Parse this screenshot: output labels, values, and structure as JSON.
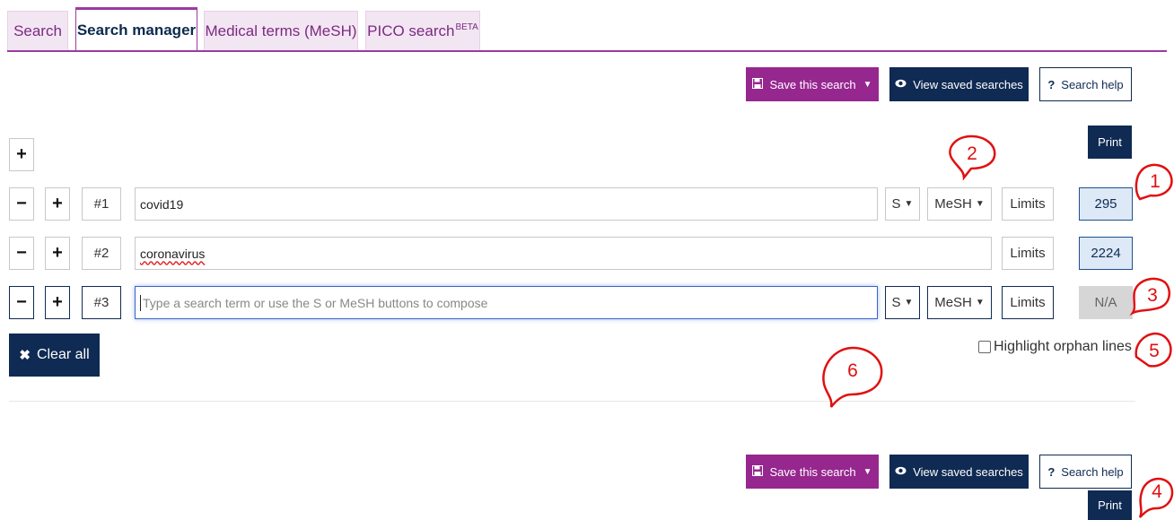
{
  "tabs": [
    {
      "label": "Search",
      "sup": ""
    },
    {
      "label": "Search manager",
      "sup": ""
    },
    {
      "label": "Medical terms (MeSH)",
      "sup": ""
    },
    {
      "label": "PICO search",
      "sup": "BETA"
    }
  ],
  "toolbar": {
    "save_label": "Save this search",
    "view_label": "View saved searches",
    "help_label": "Search help",
    "help_icon": "?"
  },
  "print_label": "Print",
  "add_symbol": "+",
  "remove_symbol": "−",
  "lines": [
    {
      "number": "#1",
      "term": "covid19",
      "s_label": "S",
      "mesh_label": "MeSH",
      "limits_label": "Limits",
      "count": "295"
    },
    {
      "number": "#2",
      "term": "coronavirus",
      "limits_label": "Limits",
      "count": "2224"
    },
    {
      "number": "#3",
      "term": "",
      "placeholder": "Type a search term or use the S or MeSH buttons to compose",
      "s_label": "S",
      "mesh_label": "MeSH",
      "limits_label": "Limits",
      "count": "N/A"
    }
  ],
  "clear_all_label": "Clear all",
  "highlight_orphan_label": "Highlight orphan lines",
  "annotations": [
    "1",
    "2",
    "3",
    "4",
    "5",
    "6"
  ],
  "colors": {
    "purple": "#96278f",
    "navy": "#0f2a53",
    "annotation_red": "#e01010",
    "count_bg": "#dde9f7"
  }
}
